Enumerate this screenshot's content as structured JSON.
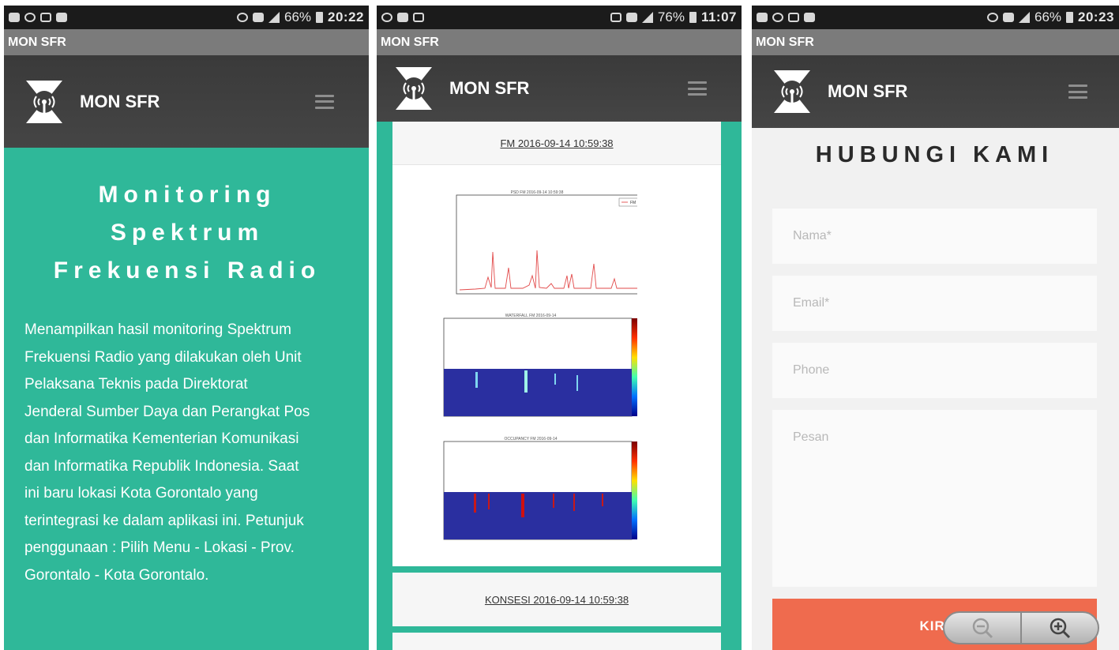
{
  "screen1": {
    "status": {
      "battery": "66%",
      "time": "20:22"
    },
    "window_title": "MON SFR",
    "brand": "MON SFR",
    "hero": {
      "title_lines": [
        "Monitoring",
        "Spektrum",
        "Frekuensi Radio"
      ],
      "text_lines": [
        "Menampilkan hasil monitoring Spektrum",
        "Frekuensi Radio yang dilakukan oleh Unit",
        "Pelaksana Teknis pada Direktorat",
        "Jenderal Sumber Daya dan Perangkat Pos",
        "dan Informatika Kementerian Komunikasi",
        "dan Informatika Republik Indonesia. Saat",
        "ini baru lokasi Kota Gorontalo yang",
        "terintegrasi ke dalam aplikasi ini. Petunjuk",
        "penggunaan : Pilih Menu - Lokasi - Prov.",
        "Gorontalo - Kota Gorontalo."
      ]
    }
  },
  "screen2": {
    "status": {
      "battery": "76%",
      "time": "11:07"
    },
    "window_title": "MON SFR",
    "brand": "MON SFR",
    "card1_link": "FM 2016-09-14 10:59:38",
    "plot_titles": [
      "PSD FM 2016-09-14 10:59:38",
      "WATERFALL FM 2016-09-14",
      "OCCUPANCY FM 2016-09-14"
    ],
    "plot_legend": "FM",
    "card2_link": "KONSESI 2016-09-14 10:59:38"
  },
  "screen3": {
    "status": {
      "battery": "66%",
      "time": "20:23"
    },
    "window_title": "MON SFR",
    "brand": "MON SFR",
    "title": "HUBUNGI KAMI",
    "fields": {
      "name": "Nama*",
      "email": "Email*",
      "phone": "Phone",
      "message": "Pesan"
    },
    "submit": "KIRI"
  },
  "colors": {
    "teal": "#2fb899",
    "navbar": "#3e3e3e",
    "titlebar": "#7b7b7b",
    "submit": "#ef6b4e",
    "statusbar": "#1b1b1b"
  },
  "icons": [
    "message-icon",
    "alarm-icon",
    "mail-icon",
    "storage-icon",
    "whatsapp-icon",
    "signal-icon",
    "battery-icon",
    "menu-icon",
    "antenna-logo",
    "zoom-out-icon",
    "zoom-in-icon"
  ]
}
